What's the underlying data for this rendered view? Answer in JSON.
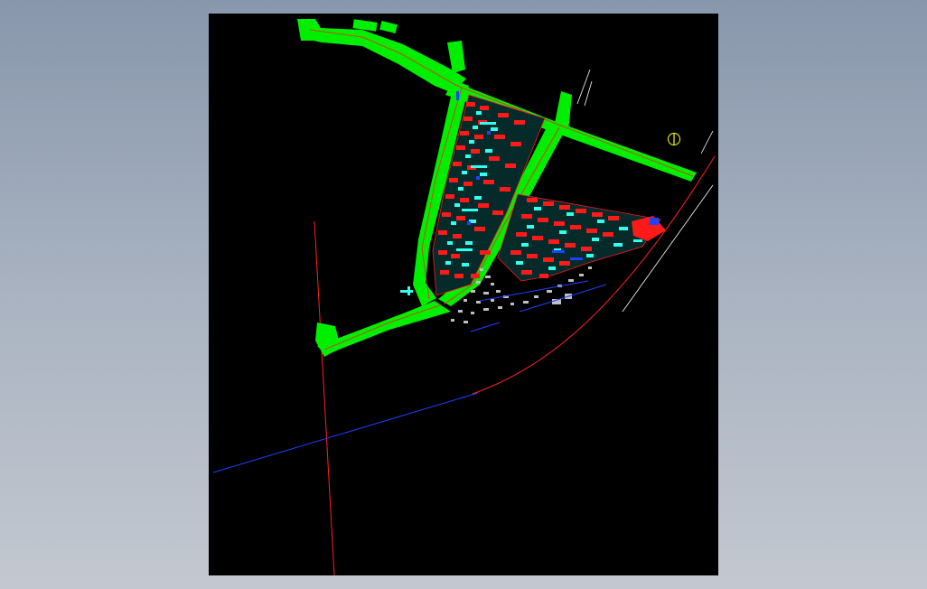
{
  "drawing": {
    "north_symbol_glyph": "N"
  },
  "colors": {
    "background": "#000000",
    "road_fill": "#00ee00",
    "road_centerline": "#ff2020",
    "building_outline": "#ff1a1a",
    "landscape_detail": "#33ffee",
    "utility_line": "#2040ff",
    "existing_terrain": "#bfbfbf",
    "boundary_line": "#ffffff",
    "north_symbol": "#ffff00"
  }
}
